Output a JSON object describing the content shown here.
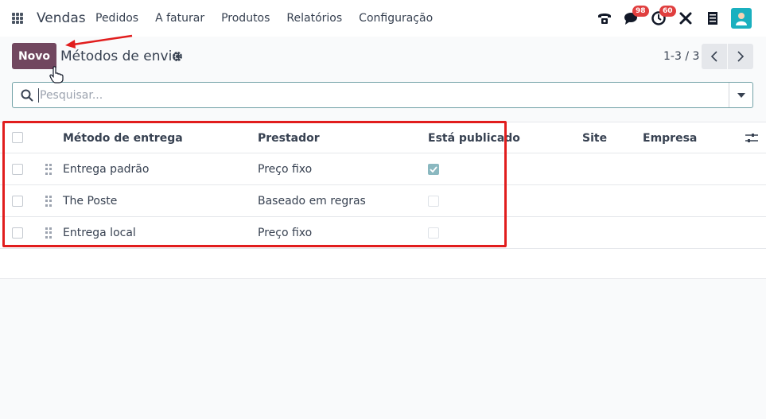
{
  "navbar": {
    "app_name": "Vendas",
    "menu": [
      "Pedidos",
      "A faturar",
      "Produtos",
      "Relatórios",
      "Configuração"
    ],
    "icons": [
      "phone-icon",
      "chat-icon",
      "activity-clock-icon",
      "tools-icon",
      "document-icon",
      "user-avatar"
    ],
    "chat_count": "98",
    "activity_count": "60"
  },
  "control": {
    "new_label": "Novo",
    "title": "Métodos de envio",
    "pager": "1-3 / 3"
  },
  "search": {
    "placeholder": "Pesquisar..."
  },
  "table": {
    "columns": [
      "Método de entrega",
      "Prestador",
      "Está publicado",
      "Site",
      "Empresa"
    ],
    "rows": [
      {
        "method": "Entrega padrão",
        "provider": "Preço fixo",
        "published": true
      },
      {
        "method": "The Poste",
        "provider": "Baseado em regras",
        "published": false
      },
      {
        "method": "Entrega local",
        "provider": "Preço fixo",
        "published": false
      }
    ]
  },
  "colors": {
    "primary": "#71475f",
    "highlight": "#e11d1d",
    "badge": "#e03e3e",
    "checked": "#8ab8c0"
  }
}
